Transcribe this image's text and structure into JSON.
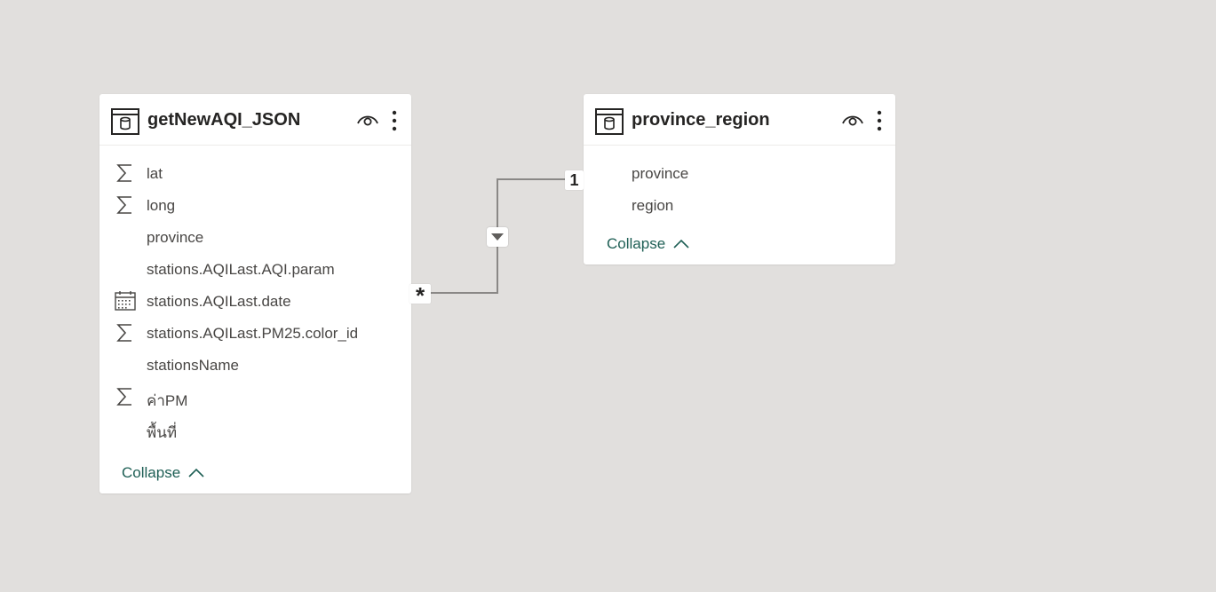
{
  "tables": [
    {
      "title": "getNewAQI_JSON",
      "fields": [
        {
          "icon": "sigma-icon",
          "label": "lat"
        },
        {
          "icon": "sigma-icon",
          "label": "long"
        },
        {
          "icon": "",
          "label": "province"
        },
        {
          "icon": "",
          "label": "stations.AQILast.AQI.param"
        },
        {
          "icon": "calendar-icon",
          "label": "stations.AQILast.date"
        },
        {
          "icon": "sigma-icon",
          "label": "stations.AQILast.PM25.color_id"
        },
        {
          "icon": "",
          "label": "stationsName"
        },
        {
          "icon": "sigma-icon",
          "label": "ค่าPM"
        },
        {
          "icon": "",
          "label": "พื้นที่"
        }
      ],
      "collapse_label": "Collapse"
    },
    {
      "title": "province_region",
      "fields": [
        {
          "icon": "",
          "label": "province"
        },
        {
          "icon": "",
          "label": "region"
        }
      ],
      "collapse_label": "Collapse"
    }
  ],
  "relationship": {
    "from_cardinality": "*",
    "to_cardinality": "1",
    "line_color": "#8a8886"
  },
  "colors": {
    "canvas": "#e1dfdd",
    "card": "#ffffff",
    "link": "#1e5f55",
    "text": "#252423"
  }
}
